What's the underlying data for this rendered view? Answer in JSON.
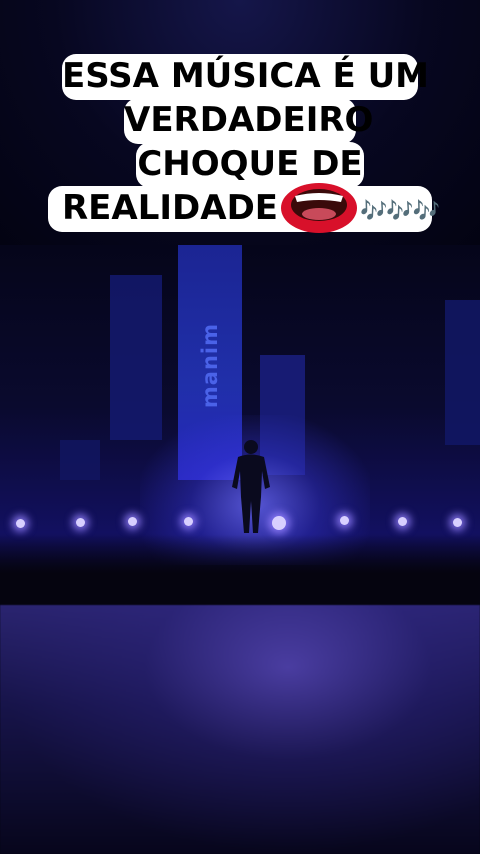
{
  "caption": {
    "line1": "ESSA MÚSICA É UM",
    "line2": "VERDADEIRO",
    "line3": "CHOQUE DE",
    "line4": "REALIDADE",
    "emoji_mouth_icon": "mouth-icon",
    "notes": "🎶🎶🎶"
  },
  "photo": {
    "screen_brand_text": "manim",
    "colors": {
      "stage_blue": "#2436c0",
      "glow": "#6e6eff"
    }
  }
}
